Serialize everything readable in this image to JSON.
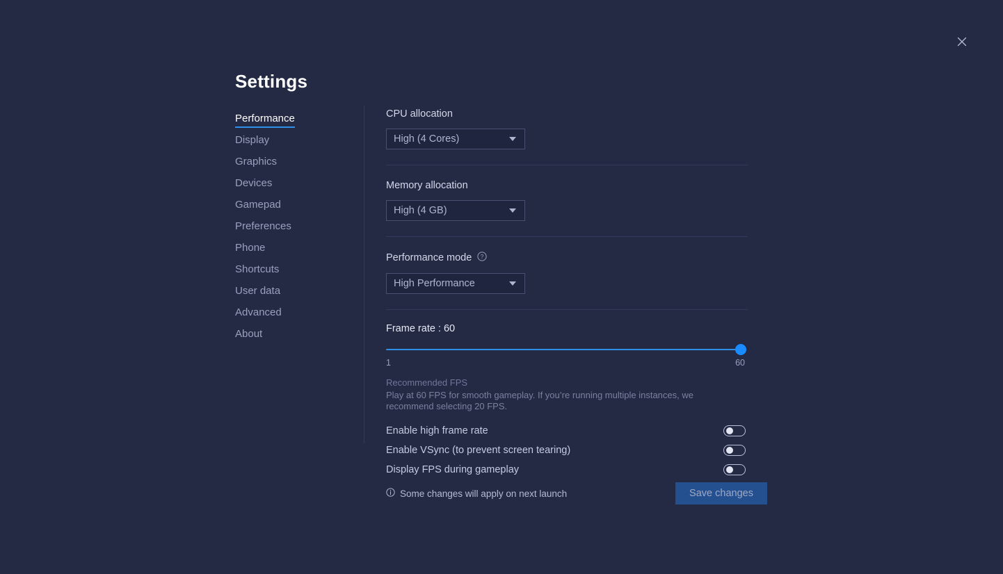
{
  "window": {
    "title": "Settings",
    "close_icon": "close-icon"
  },
  "sidebar": {
    "items": [
      {
        "label": "Performance",
        "active": true
      },
      {
        "label": "Display",
        "active": false
      },
      {
        "label": "Graphics",
        "active": false
      },
      {
        "label": "Devices",
        "active": false
      },
      {
        "label": "Gamepad",
        "active": false
      },
      {
        "label": "Preferences",
        "active": false
      },
      {
        "label": "Phone",
        "active": false
      },
      {
        "label": "Shortcuts",
        "active": false
      },
      {
        "label": "User data",
        "active": false
      },
      {
        "label": "Advanced",
        "active": false
      },
      {
        "label": "About",
        "active": false
      }
    ]
  },
  "main": {
    "cpu": {
      "label": "CPU allocation",
      "value": "High (4 Cores)"
    },
    "memory": {
      "label": "Memory allocation",
      "value": "High (4 GB)"
    },
    "performance_mode": {
      "label": "Performance mode",
      "help_icon": "help-circle-icon",
      "value": "High Performance"
    },
    "frame_rate": {
      "label": "Frame rate : 60",
      "value": 60,
      "min": 1,
      "max": 60,
      "min_label": "1",
      "max_label": "60",
      "fill_percent": 100
    },
    "hint": {
      "title": "Recommended FPS",
      "body": "Play at 60 FPS for smooth gameplay. If you’re running multiple instances, we recommend selecting 20 FPS."
    },
    "toggles": [
      {
        "label": "Enable high frame rate",
        "on": false
      },
      {
        "label": "Enable VSync (to prevent screen tearing)",
        "on": false
      },
      {
        "label": "Display FPS during gameplay",
        "on": false
      }
    ]
  },
  "footer": {
    "info_icon": "info-circle-icon",
    "note": "Some changes will apply on next launch",
    "save_label": "Save changes"
  },
  "colors": {
    "background": "#242944",
    "accent": "#2e8fe8",
    "slider_thumb": "#1a8cff",
    "save_button": "#24508f"
  }
}
